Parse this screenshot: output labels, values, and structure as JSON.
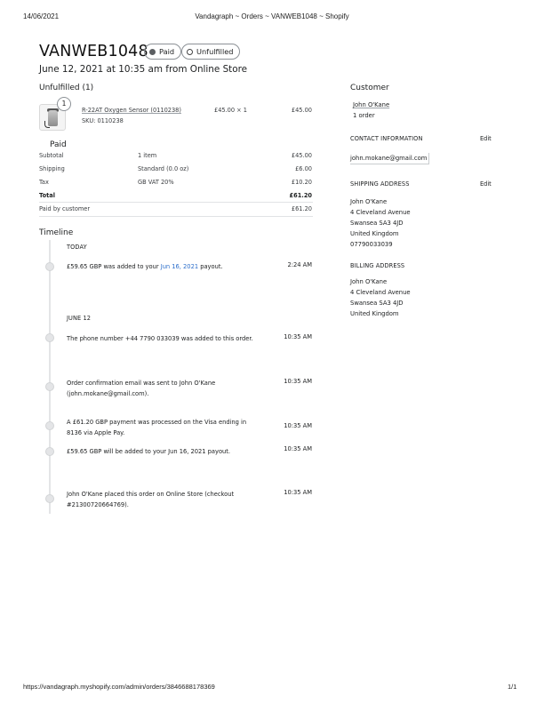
{
  "print_header": {
    "date": "14/06/2021",
    "title": "Vandagraph ~ Orders ~ VANWEB1048 ~ Shopify"
  },
  "order": {
    "number": "VANWEB1048",
    "payment_badge": "Paid",
    "fulfillment_badge": "Unfulfilled",
    "subtitle": "June 12, 2021 at 10:35 am from Online Store"
  },
  "unfulfilled": {
    "heading": "Unfulfilled (1)",
    "item": {
      "quantity_badge": "1",
      "name": "R-22AT Oxygen Sensor (0110238)",
      "sku": "SKU: 0110238",
      "price_qty": "£45.00 × 1",
      "total": "£45.00"
    }
  },
  "payment": {
    "heading": "Paid",
    "rows": [
      {
        "label": "Subtotal",
        "detail": "1 item",
        "amount": "£45.00"
      },
      {
        "label": "Shipping",
        "detail": "Standard (0.0 oz)",
        "amount": "£6.00"
      },
      {
        "label": "Tax",
        "detail": "GB VAT 20%",
        "amount": "£10.20"
      }
    ],
    "total": {
      "label": "Total",
      "amount": "£61.20"
    },
    "paid_by_customer": {
      "label": "Paid by customer",
      "amount": "£61.20"
    }
  },
  "timeline": {
    "heading": "Timeline",
    "groups": [
      {
        "label": "TODAY",
        "events": [
          {
            "before": "£59.65 GBP was added to your ",
            "link": "Jun 16, 2021",
            "after": " payout.",
            "time": "2:24 AM"
          }
        ]
      },
      {
        "label": "JUNE 12",
        "events": [
          {
            "line1": "The phone number +44 7790 033039 was added to this order.",
            "line2": "",
            "time": "10:35 AM"
          },
          {
            "line1": "Order confirmation email was sent to John O'Kane",
            "line2": "(john.mokane@gmail.com).",
            "time": "10:35 AM"
          },
          {
            "line1": "A £61.20 GBP payment was processed on the Visa ending in",
            "line2": "8136 via Apple Pay.",
            "time": "10:35 AM"
          },
          {
            "line1": "£59.65 GBP will be added to your Jun 16, 2021 payout.",
            "line2": "",
            "time": "10:35 AM"
          },
          {
            "line1": "John O'Kane placed this order on Online Store (checkout",
            "line2": "#21300720664769).",
            "time": "10:35 AM"
          }
        ]
      }
    ]
  },
  "customer": {
    "heading": "Customer",
    "name": "John O'Kane",
    "orders": "1 order",
    "contact": {
      "heading": "CONTACT INFORMATION",
      "edit": "Edit",
      "email": "john.mokane@gmail.com"
    },
    "shipping": {
      "heading": "SHIPPING ADDRESS",
      "edit": "Edit",
      "lines": [
        "John O'Kane",
        "4 Cleveland Avenue",
        "Swansea SA3 4JD",
        "United Kingdom",
        "07790033039"
      ]
    },
    "billing": {
      "heading": "BILLING ADDRESS",
      "lines": [
        "John O'Kane",
        "4 Cleveland Avenue",
        "Swansea SA3 4JD",
        "United Kingdom"
      ]
    }
  },
  "print_footer": {
    "url": "https://vandagraph.myshopify.com/admin/orders/3846688178369",
    "page": "1/1"
  }
}
